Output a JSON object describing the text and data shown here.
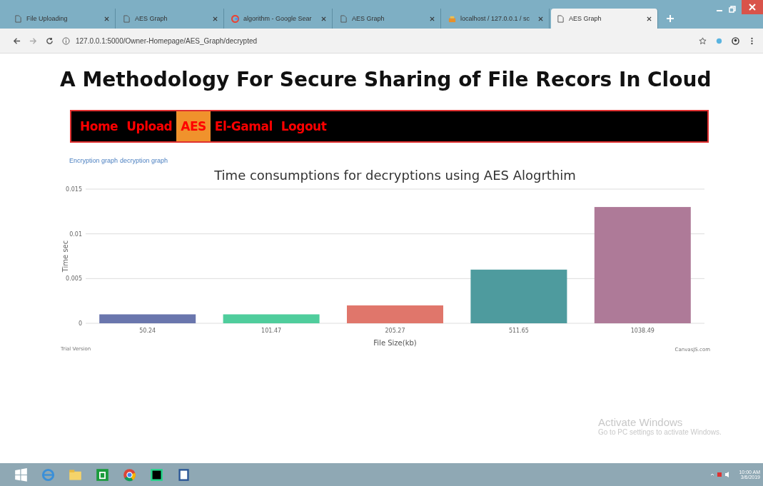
{
  "browser": {
    "tabs": [
      {
        "title": "File Uploading",
        "kind": "page",
        "selected": false
      },
      {
        "title": "AES Graph",
        "kind": "page",
        "selected": false
      },
      {
        "title": "algorithm - Google Sear",
        "kind": "search",
        "selected": false
      },
      {
        "title": "AES Graph",
        "kind": "page",
        "selected": false
      },
      {
        "title": "localhost / 127.0.0.1 / sc",
        "kind": "database",
        "selected": false
      },
      {
        "title": "AES Graph",
        "kind": "page",
        "selected": true
      }
    ],
    "url": "127.0.0.1:5000/Owner-Homepage/AES_Graph/decrypted"
  },
  "page": {
    "heading": "A Methodology For Secure Sharing of File Recors In Cloud",
    "nav": [
      {
        "label": "Home",
        "selected": false
      },
      {
        "label": "Upload",
        "selected": false
      },
      {
        "label": "AES",
        "selected": true
      },
      {
        "label": "El-Gamal",
        "selected": false
      },
      {
        "label": "Logout",
        "selected": false
      }
    ],
    "links": [
      {
        "label": "Encryption graph"
      },
      {
        "label": "decryption graph"
      }
    ],
    "chart": {
      "credit_left": "Trial Version",
      "credit_right": "CanvasJS.com",
      "chart_data": {
        "type": "bar",
        "title": "Time consumptions for decryptions using AES Alogrthim",
        "xlabel": "File Size(kb)",
        "ylabel": "Time sec",
        "categories": [
          "50.24",
          "101.47",
          "205.27",
          "511.65",
          "1038.49"
        ],
        "series": [
          {
            "colors": [
              "#6a76ad",
              "#4fcd9c",
              "#e0766b",
              "#4e9b9e",
              "#ae7a98"
            ],
            "values": [
              0.001,
              0.001,
              0.002,
              0.006,
              0.013
            ]
          }
        ],
        "ylim": [
          0,
          0.015
        ],
        "yticks": [
          0,
          0.005,
          0.01,
          0.015
        ]
      }
    }
  },
  "activation": {
    "title": "Activate Windows",
    "subtitle": "Go to PC settings to activate Windows."
  },
  "taskbar": {
    "time": "10:00 AM",
    "date": "3/6/2019"
  }
}
